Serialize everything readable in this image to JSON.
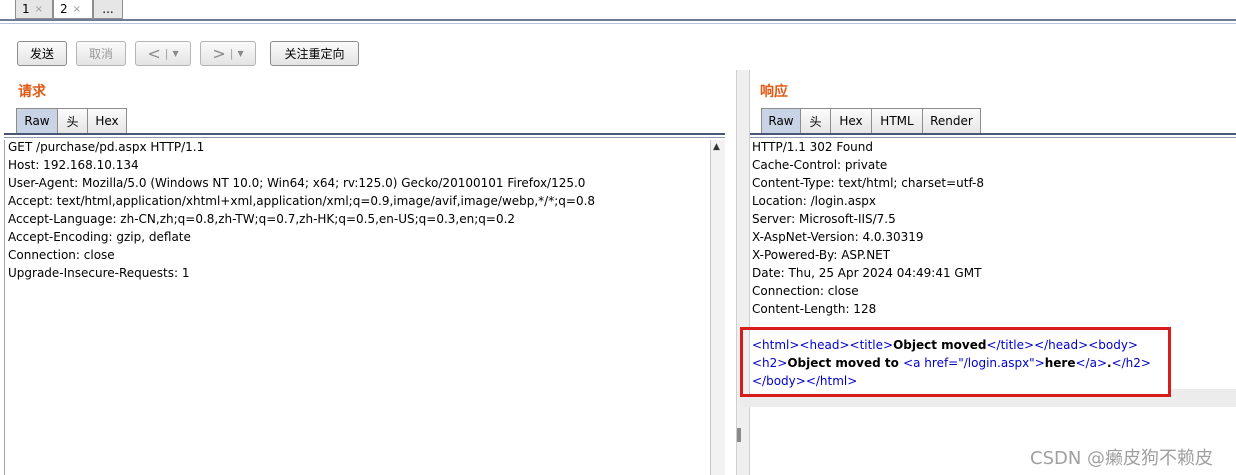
{
  "top_tabs": [
    {
      "label": "1",
      "close": "×"
    },
    {
      "label": "2",
      "close": "×"
    },
    {
      "label": "..."
    }
  ],
  "toolbar": {
    "send_label": "发送",
    "cancel_label": "取消",
    "back_glyph": "<",
    "forward_glyph": ">",
    "dropdown_glyph": "▼",
    "follow_redirect_label": "关注重定向"
  },
  "request": {
    "title": "请求",
    "tabs": [
      "Raw",
      "头",
      "Hex"
    ],
    "lines": [
      "GET /purchase/pd.aspx HTTP/1.1",
      "Host: 192.168.10.134",
      "User-Agent: Mozilla/5.0 (Windows NT 10.0; Win64; x64; rv:125.0) Gecko/20100101 Firefox/125.0",
      "Accept: text/html,application/xhtml+xml,application/xml;q=0.9,image/avif,image/webp,*/*;q=0.8",
      "Accept-Language: zh-CN,zh;q=0.8,zh-TW;q=0.7,zh-HK;q=0.5,en-US;q=0.3,en;q=0.2",
      "Accept-Encoding: gzip, deflate",
      "Connection: close",
      "Upgrade-Insecure-Requests: 1"
    ]
  },
  "response": {
    "title": "响应",
    "tabs": [
      "Raw",
      "头",
      "Hex",
      "HTML",
      "Render"
    ],
    "lines": [
      "HTTP/1.1 302 Found",
      "Cache-Control: private",
      "Content-Type: text/html; charset=utf-8",
      "Location: /login.aspx",
      "Server: Microsoft-IIS/7.5",
      "X-AspNet-Version: 4.0.30319",
      "X-Powered-By: ASP.NET",
      "Date: Thu, 25 Apr 2024 04:49:41 GMT",
      "Connection: close",
      "Content-Length: 128"
    ],
    "body": {
      "l1_open": "<html><head><title>",
      "l1_title": "Object moved",
      "l1_close": "</title></head><body>",
      "l2_open": "<h2>",
      "l2_text": "Object moved to ",
      "l2_a_open": "<a href=\"/login.aspx\">",
      "l2_link": "here",
      "l2_a_close": "</a>",
      "l2_dot": ".",
      "l2_close": "</h2>",
      "l3": "</body></html>"
    }
  },
  "watermark": "CSDN @癞皮狗不赖皮",
  "colors": {
    "panel_title": "#e05a16",
    "active_tab": "#c9d3e6",
    "highlight_border": "#d81c1c",
    "tag": "#0000cc"
  }
}
